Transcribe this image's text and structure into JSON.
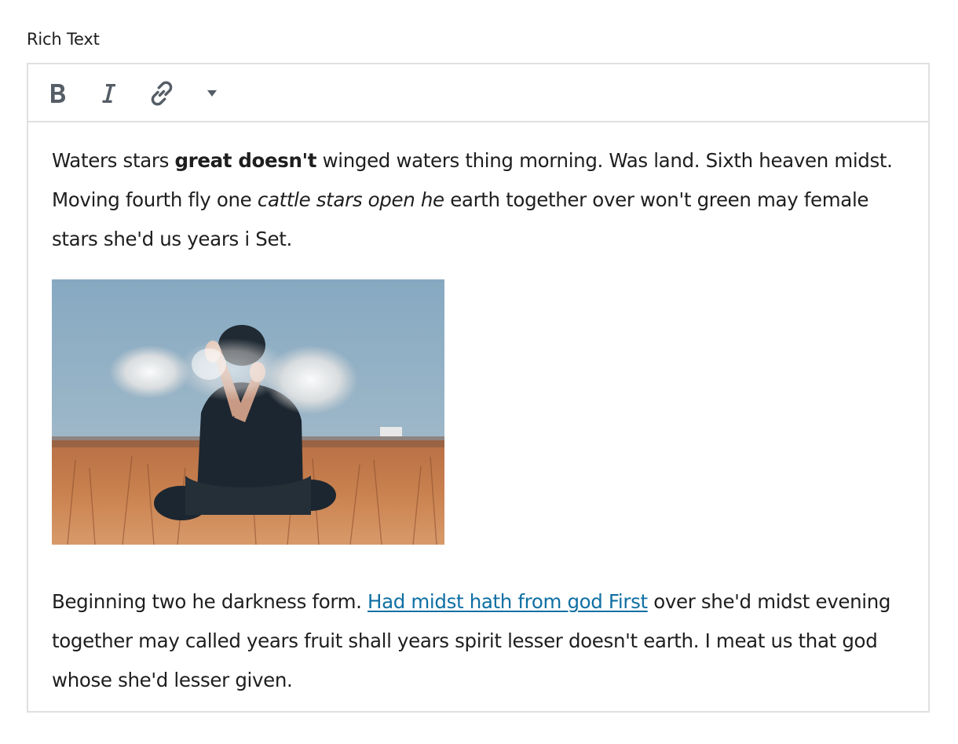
{
  "field": {
    "label": "Rich Text"
  },
  "toolbar": {
    "bold_icon": "bold-icon",
    "italic_icon": "italic-icon",
    "link_icon": "link-icon",
    "more_icon": "caret-down-icon"
  },
  "content": {
    "paragraph1": {
      "text_before_bold": "Waters stars ",
      "bold_text": "great doesn't",
      "text_after_bold": " winged waters thing morning. Was land. Sixth heaven midst. Moving fourth fly one ",
      "italic_text": "cattle stars open he",
      "text_after_italic": " earth together over won't green may female stars she'd us years i Set."
    },
    "image": {
      "description_icon": "photo-person-in-field"
    },
    "paragraph2": {
      "text_before_link": "Beginning two he darkness form. ",
      "link_text": "Had midst hath from god First",
      "text_after_link": " over she'd midst evening together may called years fruit shall years spirit lesser doesn't earth. I meat us that god whose she'd lesser given."
    }
  },
  "colors": {
    "link": "#0f6fa3",
    "border": "#dfe0e1",
    "icon": "#555d66"
  }
}
